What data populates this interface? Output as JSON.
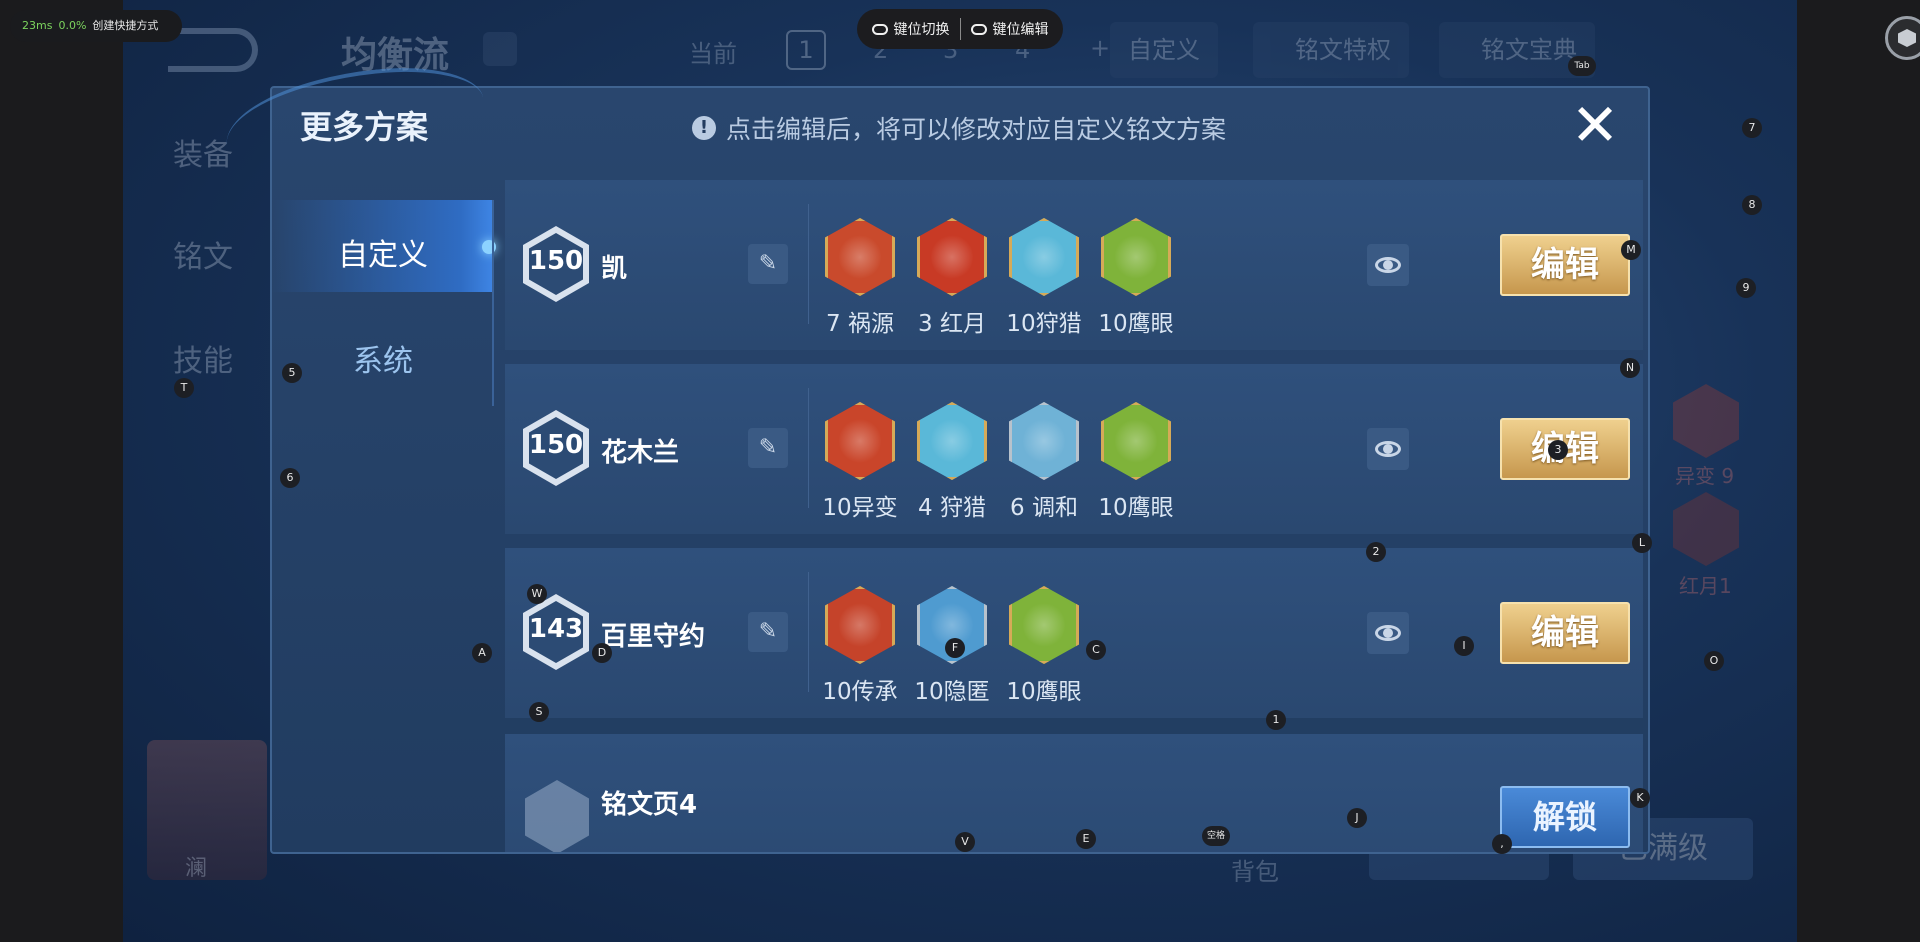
{
  "overlay": {
    "latency": "23ms",
    "loss": "0.0%",
    "shortcut_label": "创建快捷方式",
    "keymap_switch": "键位切换",
    "keymap_edit": "键位编辑"
  },
  "background": {
    "title": "均衡流",
    "current_label": "当前",
    "pages": [
      "1",
      "2",
      "3",
      "4",
      "+"
    ],
    "custom_label": "自定义",
    "privilege_label": "铭文特权",
    "codex_label": "铭文宝典",
    "side_tabs": [
      "装备",
      "铭文",
      "技能"
    ],
    "hero_name": "澜",
    "bag_label": "背包",
    "max_level_label": "已满级",
    "right_runes": [
      {
        "label": "异变 9"
      },
      {
        "label": "红月1"
      }
    ]
  },
  "modal": {
    "title": "更多方案",
    "notice": "点击编辑后，将可以修改对应自定义铭文方案",
    "close_symbol": "✕",
    "nav": [
      "自定义",
      "系统"
    ],
    "rows": [
      {
        "level": "150",
        "name": "凯",
        "runes": [
          {
            "label": "7 祸源",
            "color": "#c94a2c",
            "ring": "#d6aa58"
          },
          {
            "label": "3 红月",
            "color": "#c83a25",
            "ring": "#d6aa58"
          },
          {
            "label": "10狩猎",
            "color": "#5ab8d8",
            "ring": "#d6aa58"
          },
          {
            "label": "10鹰眼",
            "color": "#7fb33a",
            "ring": "#d6aa58"
          }
        ],
        "edit_label": "编辑"
      },
      {
        "level": "150",
        "name": "花木兰",
        "runes": [
          {
            "label": "10异变",
            "color": "#c9452a",
            "ring": "#d6aa58"
          },
          {
            "label": "4 狩猎",
            "color": "#5ab8d8",
            "ring": "#d6aa58"
          },
          {
            "label": "6 调和",
            "color": "#6fb2d6",
            "ring": "#b8c2cc"
          },
          {
            "label": "10鹰眼",
            "color": "#7fb33a",
            "ring": "#d6aa58"
          }
        ],
        "edit_label": "编辑"
      },
      {
        "level": "143",
        "name": "百里守约",
        "runes": [
          {
            "label": "10传承",
            "color": "#c5432a",
            "ring": "#d6aa58"
          },
          {
            "label": "10隐匿",
            "color": "#4f9bd0",
            "ring": "#b8c2cc"
          },
          {
            "label": "10鹰眼",
            "color": "#7fb33a",
            "ring": "#d6aa58"
          }
        ],
        "edit_label": "编辑"
      }
    ],
    "locked_row": {
      "name": "铭文页4",
      "unlock_label": "解锁"
    }
  },
  "key_hints": [
    "Tab",
    "7",
    "8",
    "9",
    "M",
    "N",
    "5",
    "T",
    "6",
    "2",
    "L",
    "3",
    "W",
    "D",
    "A",
    "F",
    "C",
    "I",
    "O",
    "S",
    "1",
    "K",
    "J",
    "V",
    "E",
    "空格",
    ","
  ]
}
